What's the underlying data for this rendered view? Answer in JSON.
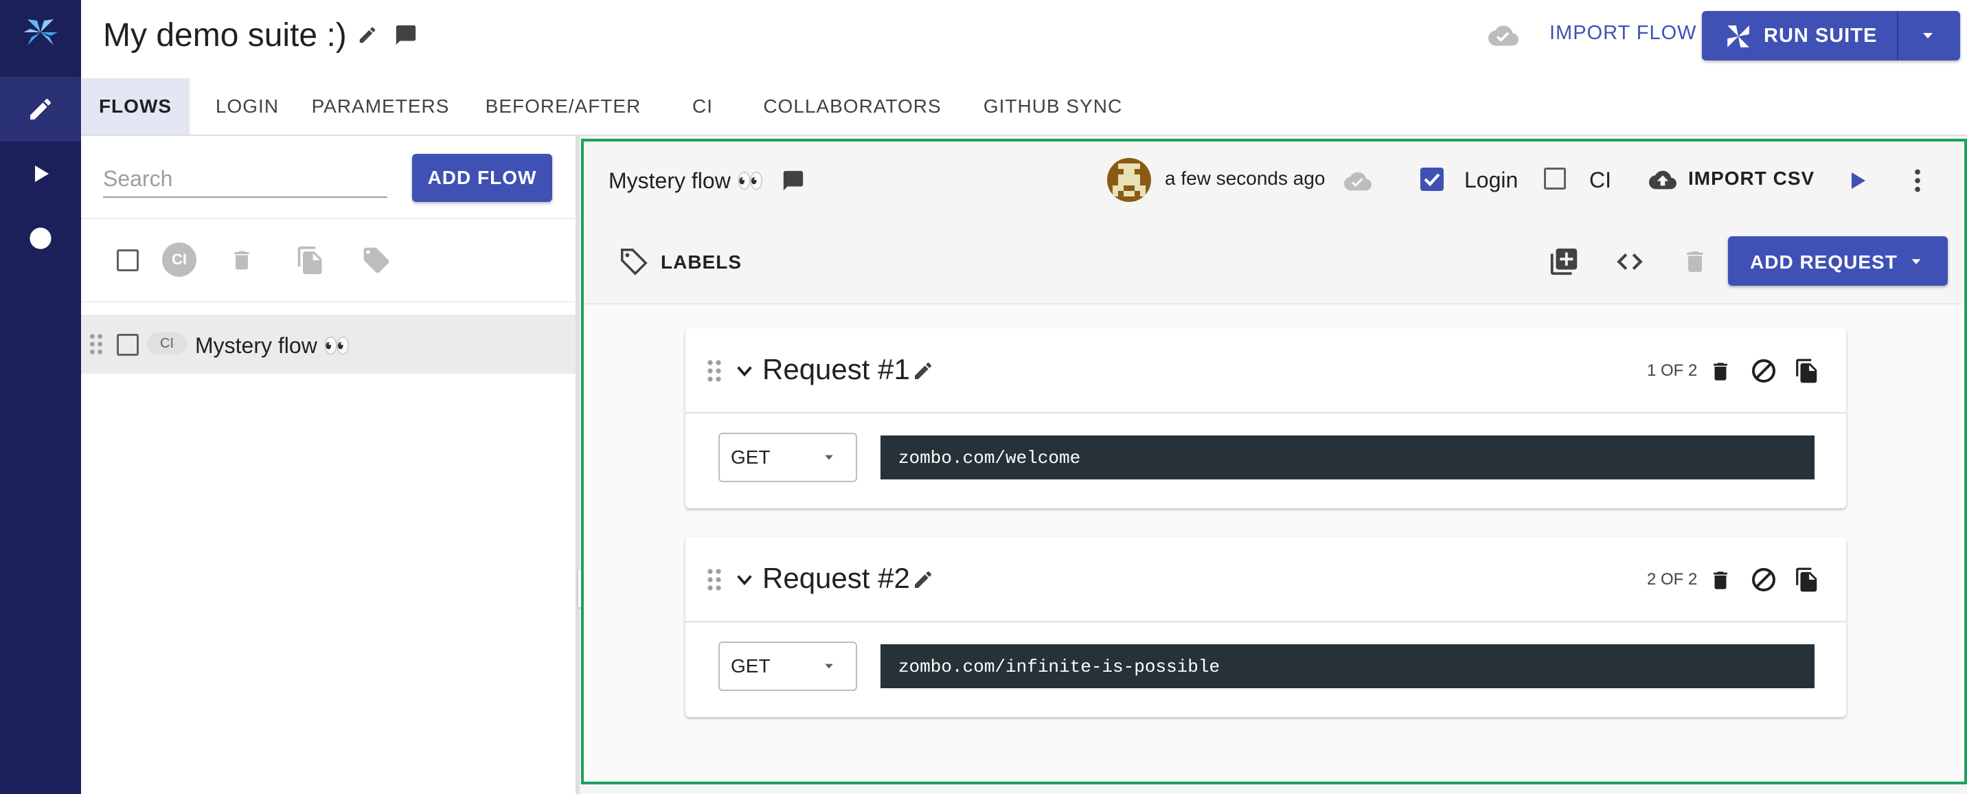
{
  "header": {
    "suite_title": "My demo suite :)",
    "import_flow_label": "IMPORT FLOW",
    "run_suite_label": "RUN SUITE"
  },
  "tabs": [
    {
      "label": "FLOWS",
      "active": true
    },
    {
      "label": "LOGIN"
    },
    {
      "label": "PARAMETERS"
    },
    {
      "label": "BEFORE/AFTER"
    },
    {
      "label": "CI"
    },
    {
      "label": "COLLABORATORS"
    },
    {
      "label": "GITHUB SYNC"
    }
  ],
  "sidebar": {
    "search_placeholder": "Search",
    "add_flow_label": "ADD FLOW",
    "bulk_ci_label": "CI",
    "flows": [
      {
        "ci_label": "CI",
        "name": "Mystery flow 👀"
      }
    ]
  },
  "flow": {
    "name": "Mystery flow 👀",
    "saved_time": "a few seconds ago",
    "login_label": "Login",
    "login_checked": true,
    "ci_label": "CI",
    "ci_checked": false,
    "import_csv_label": "IMPORT CSV",
    "labels_label": "LABELS",
    "add_request_label": "ADD REQUEST",
    "requests": [
      {
        "title": "Request #1",
        "count": "1 OF 2",
        "method": "GET",
        "url": "zombo.com/welcome"
      },
      {
        "title": "Request #2",
        "count": "2 OF 2",
        "method": "GET",
        "url": "zombo.com/infinite-is-possible"
      }
    ]
  },
  "colors": {
    "brand": "#3f51b5",
    "rail": "#1b1f5a",
    "focus_border": "#1aa260",
    "url_bg": "#263238"
  }
}
